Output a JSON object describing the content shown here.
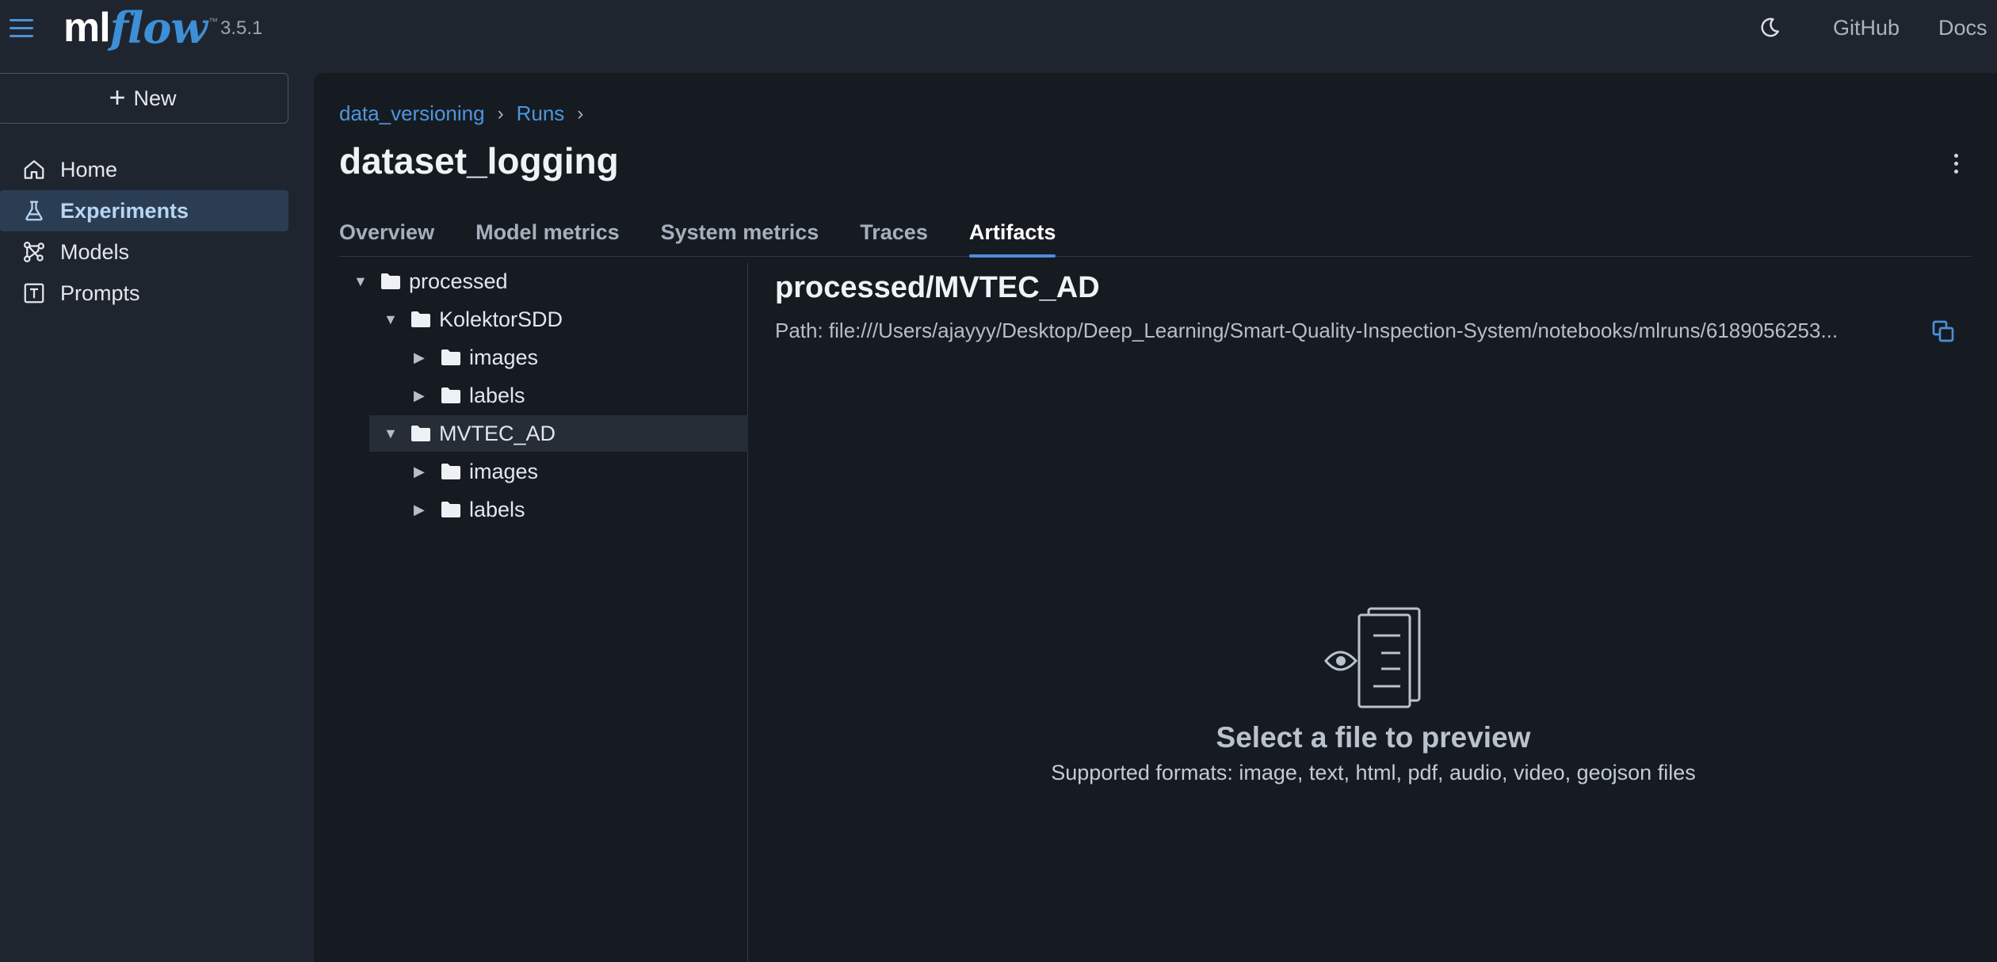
{
  "header": {
    "logo_ml": "ml",
    "logo_flow": "flow",
    "logo_tm": "™",
    "version": "3.5.1",
    "github_label": "GitHub",
    "docs_label": "Docs"
  },
  "sidebar": {
    "new_label": "New",
    "items": [
      {
        "label": "Home",
        "icon": "home-icon"
      },
      {
        "label": "Experiments",
        "icon": "flask-icon",
        "active": true
      },
      {
        "label": "Models",
        "icon": "models-icon"
      },
      {
        "label": "Prompts",
        "icon": "prompts-icon"
      }
    ]
  },
  "breadcrumb": {
    "items": [
      "data_versioning",
      "Runs"
    ],
    "separator": "›"
  },
  "page_title": "dataset_logging",
  "tabs": [
    {
      "label": "Overview"
    },
    {
      "label": "Model metrics"
    },
    {
      "label": "System metrics"
    },
    {
      "label": "Traces"
    },
    {
      "label": "Artifacts",
      "active": true
    }
  ],
  "tree": [
    {
      "label": "processed",
      "expanded": true
    },
    {
      "label": "KolektorSDD",
      "expanded": true
    },
    {
      "label": "images",
      "expanded": false
    },
    {
      "label": "labels",
      "expanded": false
    },
    {
      "label": "MVTEC_AD",
      "expanded": true,
      "selected": true
    },
    {
      "label": "images",
      "expanded": false
    },
    {
      "label": "labels",
      "expanded": false
    }
  ],
  "preview": {
    "title": "processed/MVTEC_AD",
    "path": "Path: file:///Users/ajayyy/Desktop/Deep_Learning/Smart-Quality-Inspection-System/notebooks/mlruns/6189056253...",
    "empty_title": "Select a file to preview",
    "empty_subtitle": "Supported formats: image, text, html, pdf, audio, video, geojson files"
  },
  "colors": {
    "accent": "#4a90d9",
    "background": "#1f252e",
    "panel": "#161b22",
    "active_nav": "#2b3d52"
  }
}
